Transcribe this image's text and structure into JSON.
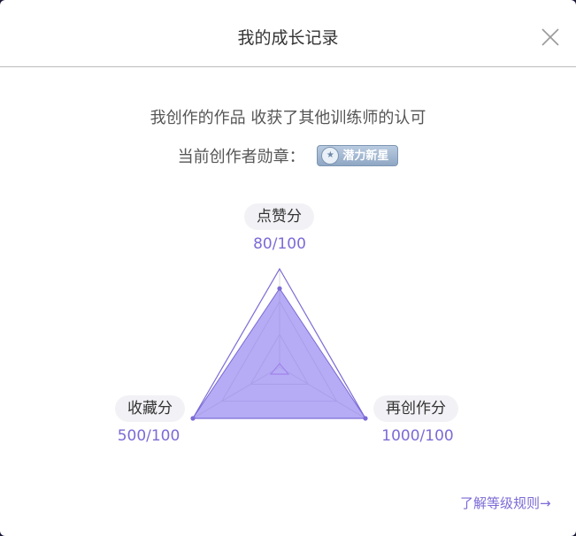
{
  "dialog": {
    "title": "我的成长记录",
    "close_icon": "close-icon"
  },
  "intro_text": "我创作的作品 收获了其他训练师的认可",
  "badge": {
    "label": "当前创作者勋章：",
    "name": "潜力新星",
    "icon": "star-medal-icon"
  },
  "radar": {
    "axes": [
      {
        "name": "点赞分",
        "score_text": "80/100",
        "value": 80,
        "max": 100
      },
      {
        "name": "再创作分",
        "score_text": "1000/100",
        "value": 1000,
        "max": 100
      },
      {
        "name": "收藏分",
        "score_text": "500/100",
        "value": 500,
        "max": 100
      }
    ],
    "colors": {
      "outline": "#7b6bd6",
      "fill": "#8f7ff0",
      "grid": "#d9d9d9",
      "accent": "#c58be6"
    }
  },
  "rules_link": "了解等级规则→"
}
